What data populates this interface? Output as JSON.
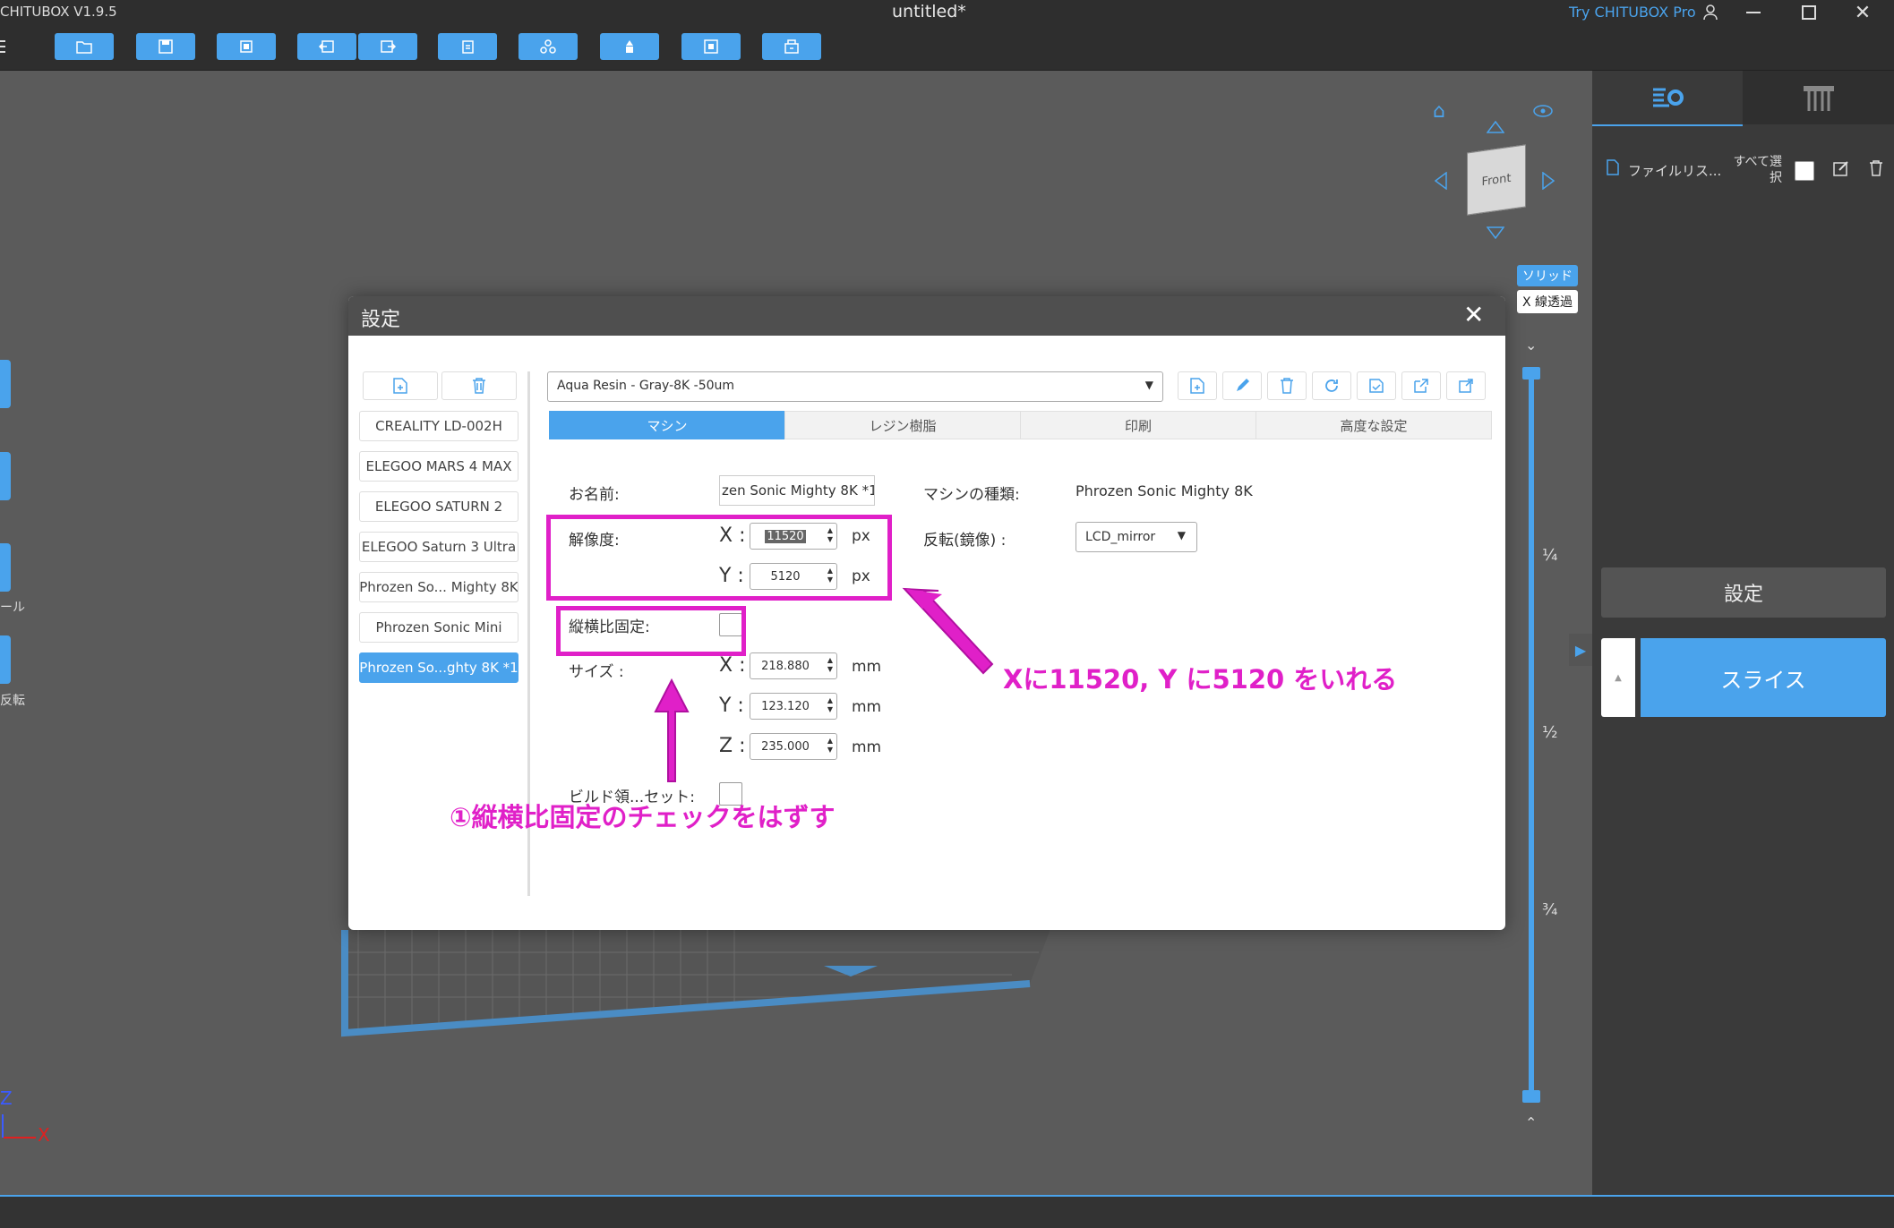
{
  "app": {
    "title": "CHITUBOX V1.9.5",
    "document": "untitled*",
    "try_pro": "Try CHITUBOX Pro"
  },
  "toolbar": {
    "buttons": [
      "open-icon",
      "save-icon",
      "import-icon",
      "undo-icon",
      "redo-icon",
      "copy-icon",
      "group-icon",
      "support-icon",
      "hollow-icon",
      "print-icon"
    ]
  },
  "view": {
    "solid_label": "ソリッド",
    "xray_label": "X 線透過",
    "cube_face": "Front",
    "axis_z": "Z",
    "axis_x": "X",
    "slider_marks": [
      "¼",
      "½",
      "¾"
    ]
  },
  "left_side_labels": [
    "ール",
    "反転"
  ],
  "right_panel": {
    "file_list": "ファイルリス...",
    "select_all": "すべて選択",
    "settings_button": "設定",
    "slice_button": "スライス"
  },
  "dialog": {
    "title": "設定",
    "profile_select": "Aqua Resin - Gray-8K -50um",
    "printers": [
      "CREALITY LD-002H",
      "ELEGOO MARS 4 MAX",
      "ELEGOO SATURN 2",
      "ELEGOO Saturn 3 Ultra",
      "Phrozen So... Mighty 8K",
      "Phrozen Sonic Mini",
      "Phrozen So...ghty 8K *1"
    ],
    "selected_printer_index": 6,
    "tabs": [
      "マシン",
      "レジン樹脂",
      "印刷",
      "高度な設定"
    ],
    "selected_tab_index": 0,
    "machine": {
      "name_label": "お名前:",
      "name_value": "zen Sonic Mighty 8K *1",
      "type_label": "マシンの種類:",
      "type_value": "Phrozen Sonic Mighty 8K",
      "resolution_label": "解像度:",
      "res_x": "11520",
      "res_y": "5120",
      "res_unit": "px",
      "mirror_label": "反転(鏡像) :",
      "mirror_value": "LCD_mirror",
      "aspect_label": "縦横比固定:",
      "size_label": "サイズ :",
      "size_x": "218.880",
      "size_y": "123.120",
      "size_z": "235.000",
      "size_unit": "mm",
      "build_label": "ビルド領...セット:",
      "x_axis": "X :",
      "y_axis": "Y :",
      "z_axis": "Z :"
    }
  },
  "annotations": {
    "note1": "Xに11520, Y に5120 をいれる",
    "note2": "①縦横比固定のチェックをはずす"
  },
  "colors": {
    "accent": "#4aa3ec",
    "annotation": "#e020c8",
    "titlebar": "#2e2e2e",
    "viewport": "#5b5b5b"
  }
}
